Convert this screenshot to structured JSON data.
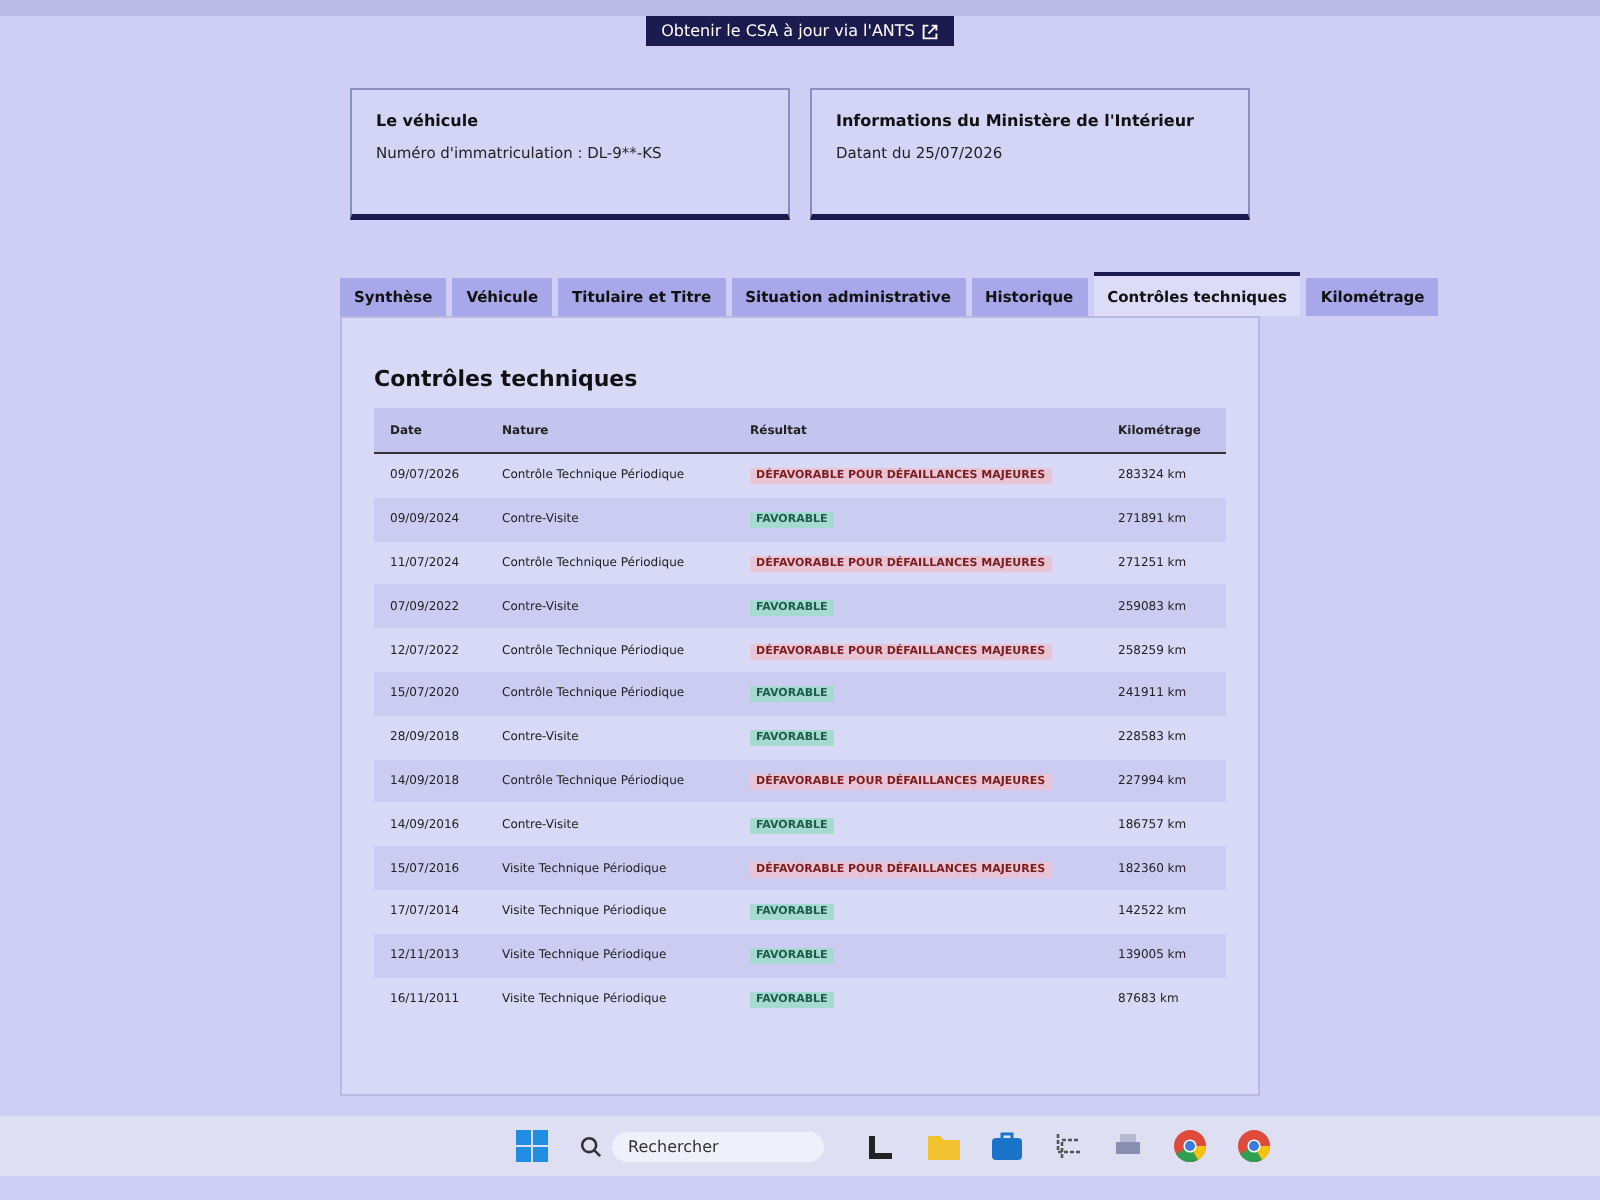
{
  "top_button": {
    "label": "Obtenir le CSA à jour via l'ANTS"
  },
  "cards": [
    {
      "title": "Le véhicule",
      "text": "Numéro d'immatriculation : DL-9**-KS"
    },
    {
      "title": "Informations du Ministère de l'Intérieur",
      "text": "Datant du 25/07/2026"
    }
  ],
  "tabs": [
    {
      "label": "Synthèse",
      "selected": false
    },
    {
      "label": "Véhicule",
      "selected": false
    },
    {
      "label": "Titulaire et Titre",
      "selected": false
    },
    {
      "label": "Situation administrative",
      "selected": false
    },
    {
      "label": "Historique",
      "selected": false
    },
    {
      "label": "Contrôles techniques",
      "selected": true
    },
    {
      "label": "Kilométrage",
      "selected": false
    }
  ],
  "section_title": "Contrôles techniques",
  "table": {
    "columns": [
      "Date",
      "Nature",
      "Résultat",
      "Kilométrage"
    ],
    "rows": [
      {
        "date": "09/07/2026",
        "nature": "Contrôle Technique Périodique",
        "result": "DÉFAVORABLE POUR DÉFAILLANCES MAJEURES",
        "kind": "unfavorable",
        "km": "283324 km"
      },
      {
        "date": "09/09/2024",
        "nature": "Contre-Visite",
        "result": "FAVORABLE",
        "kind": "favorable",
        "km": "271891 km"
      },
      {
        "date": "11/07/2024",
        "nature": "Contrôle Technique Périodique",
        "result": "DÉFAVORABLE POUR DÉFAILLANCES MAJEURES",
        "kind": "unfavorable",
        "km": "271251 km"
      },
      {
        "date": "07/09/2022",
        "nature": "Contre-Visite",
        "result": "FAVORABLE",
        "kind": "favorable",
        "km": "259083 km"
      },
      {
        "date": "12/07/2022",
        "nature": "Contrôle Technique Périodique",
        "result": "DÉFAVORABLE POUR DÉFAILLANCES MAJEURES",
        "kind": "unfavorable",
        "km": "258259 km"
      },
      {
        "date": "15/07/2020",
        "nature": "Contrôle Technique Périodique",
        "result": "FAVORABLE",
        "kind": "favorable",
        "km": "241911 km"
      },
      {
        "date": "28/09/2018",
        "nature": "Contre-Visite",
        "result": "FAVORABLE",
        "kind": "favorable",
        "km": "228583 km"
      },
      {
        "date": "14/09/2018",
        "nature": "Contrôle Technique Périodique",
        "result": "DÉFAVORABLE POUR DÉFAILLANCES MAJEURES",
        "kind": "unfavorable",
        "km": "227994 km"
      },
      {
        "date": "14/09/2016",
        "nature": "Contre-Visite",
        "result": "FAVORABLE",
        "kind": "favorable",
        "km": "186757 km"
      },
      {
        "date": "15/07/2016",
        "nature": "Visite Technique Périodique",
        "result": "DÉFAVORABLE POUR DÉFAILLANCES MAJEURES",
        "kind": "unfavorable",
        "km": "182360 km"
      },
      {
        "date": "17/07/2014",
        "nature": "Visite Technique Périodique",
        "result": "FAVORABLE",
        "kind": "favorable",
        "km": "142522 km"
      },
      {
        "date": "12/11/2013",
        "nature": "Visite Technique Périodique",
        "result": "FAVORABLE",
        "kind": "favorable",
        "km": "139005 km"
      },
      {
        "date": "16/11/2011",
        "nature": "Visite Technique Périodique",
        "result": "FAVORABLE",
        "kind": "favorable",
        "km": "87683 km"
      }
    ]
  },
  "taskbar": {
    "search_placeholder": "Rechercher"
  }
}
